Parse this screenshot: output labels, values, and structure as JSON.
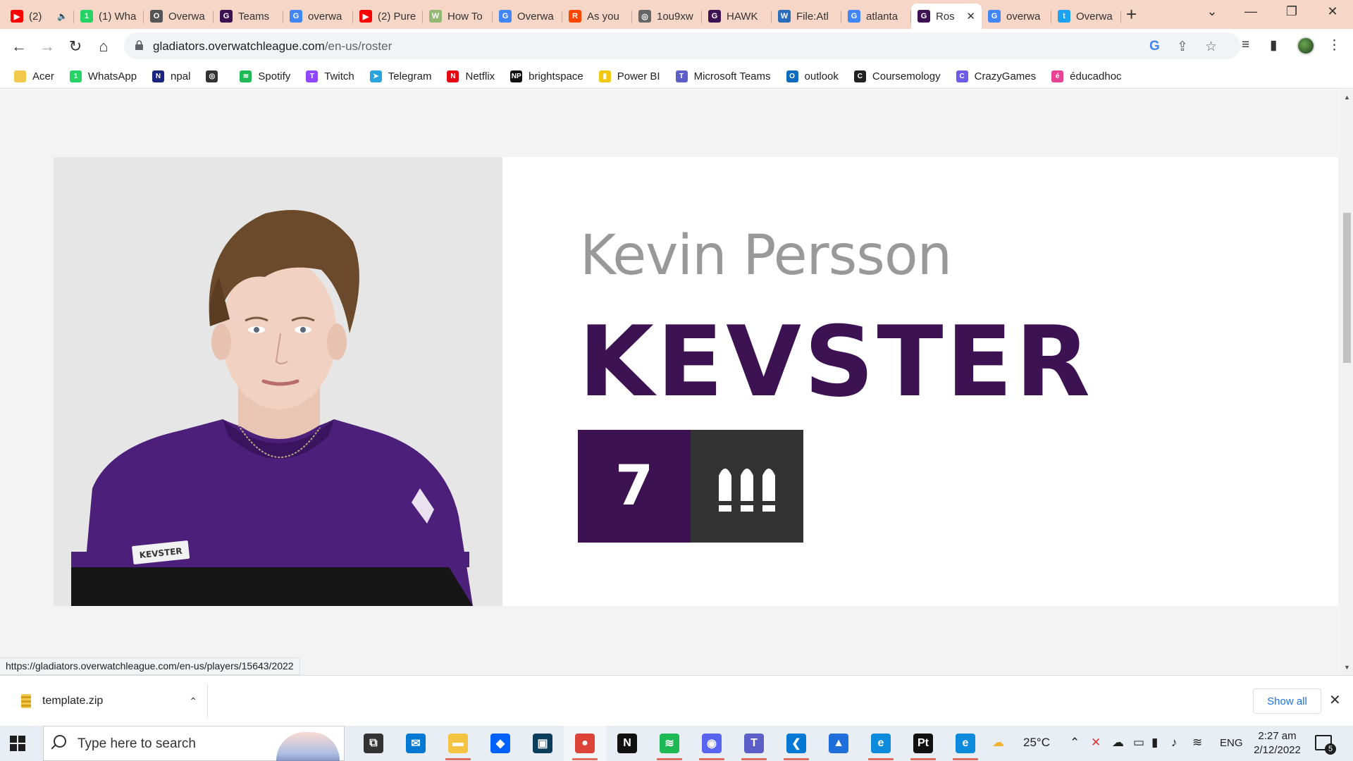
{
  "browser": {
    "tabs": [
      {
        "title": "(2)",
        "fav": "youtube-icon",
        "color": "#ff0000",
        "glyph": "▶",
        "muted": true
      },
      {
        "title": "(1) Wha",
        "fav": "whatsapp-icon",
        "color": "#25d366",
        "glyph": "1"
      },
      {
        "title": "Overwa",
        "fav": "overwatch-icon",
        "color": "#555555",
        "glyph": "O"
      },
      {
        "title": "Teams",
        "fav": "gladiators-icon",
        "color": "#3d1253",
        "glyph": "G"
      },
      {
        "title": "overwa",
        "fav": "google-icon",
        "color": "#4285f4",
        "glyph": "G"
      },
      {
        "title": "(2) Pure",
        "fav": "youtube-icon",
        "color": "#ff0000",
        "glyph": "▶"
      },
      {
        "title": "How To",
        "fav": "wikihow-icon",
        "color": "#93b874",
        "glyph": "W"
      },
      {
        "title": "Overwa",
        "fav": "google-icon",
        "color": "#4285f4",
        "glyph": "G"
      },
      {
        "title": "As you",
        "fav": "reddit-icon",
        "color": "#ff4500",
        "glyph": "R"
      },
      {
        "title": "1ou9xw",
        "fav": "globe-icon",
        "color": "#666666",
        "glyph": "◎"
      },
      {
        "title": "HAWK",
        "fav": "gladiators-icon",
        "color": "#3d1253",
        "glyph": "G"
      },
      {
        "title": "File:Atl",
        "fav": "wiki-icon",
        "color": "#2a6ebb",
        "glyph": "W"
      },
      {
        "title": "atlanta",
        "fav": "google-icon",
        "color": "#4285f4",
        "glyph": "G"
      },
      {
        "title": "Ros",
        "fav": "gladiators-icon",
        "color": "#3d1253",
        "glyph": "G",
        "active": true
      },
      {
        "title": "overwa",
        "fav": "google-icon",
        "color": "#4285f4",
        "glyph": "G"
      },
      {
        "title": "Overwa",
        "fav": "twitter-icon",
        "color": "#1da1f2",
        "glyph": "t"
      }
    ],
    "url": {
      "host": "gladiators.overwatchleague.com",
      "path": "/en-us/roster"
    },
    "bookmarks": [
      {
        "label": "Acer",
        "color": "#f2c94c",
        "glyph": ""
      },
      {
        "label": "WhatsApp",
        "color": "#25d366",
        "glyph": "1"
      },
      {
        "label": "npal",
        "color": "#1a237e",
        "glyph": "N"
      },
      {
        "label": "",
        "color": "#333333",
        "glyph": "◎"
      },
      {
        "label": "Spotify",
        "color": "#1db954",
        "glyph": "≋"
      },
      {
        "label": "Twitch",
        "color": "#9146ff",
        "glyph": "T"
      },
      {
        "label": "Telegram",
        "color": "#2aa3df",
        "glyph": "➤"
      },
      {
        "label": "Netflix",
        "color": "#e50914",
        "glyph": "N"
      },
      {
        "label": "brightspace",
        "color": "#111111",
        "glyph": "NP"
      },
      {
        "label": "Power BI",
        "color": "#f2c811",
        "glyph": "▮"
      },
      {
        "label": "Microsoft Teams",
        "color": "#5b5fc7",
        "glyph": "T"
      },
      {
        "label": "outlook",
        "color": "#0f6cbd",
        "glyph": "O"
      },
      {
        "label": "Coursemology",
        "color": "#222222",
        "glyph": "C"
      },
      {
        "label": "CrazyGames",
        "color": "#6c5ce7",
        "glyph": "C"
      },
      {
        "label": "éducadhoc",
        "color": "#e84393",
        "glyph": "é"
      }
    ]
  },
  "player": {
    "real_name": "Kevin Persson",
    "gamertag": "KEVSTER",
    "number": "7",
    "role_icon": "damage-role-icon",
    "jersey_label": "KEVSTER"
  },
  "status_url": "https://gladiators.overwatchleague.com/en-us/players/15643/2022",
  "download": {
    "filename": "template.zip",
    "show_all": "Show all"
  },
  "taskbar": {
    "search_placeholder": "Type here to search",
    "apps": [
      {
        "name": "task-view-icon",
        "color": "#333333",
        "glyph": "⧉"
      },
      {
        "name": "mail-icon",
        "color": "#0078d4",
        "glyph": "✉"
      },
      {
        "name": "file-explorer-icon",
        "color": "#f5c342",
        "glyph": "▬",
        "running": true
      },
      {
        "name": "dropbox-icon",
        "color": "#0061ff",
        "glyph": "◆"
      },
      {
        "name": "app-icon",
        "color": "#0b3d5c",
        "glyph": "▣"
      },
      {
        "name": "chrome-icon",
        "color": "#db4437",
        "glyph": "●",
        "running": true,
        "active": true
      },
      {
        "name": "netflix-icon",
        "color": "#111111",
        "glyph": "N"
      },
      {
        "name": "spotify-icon",
        "color": "#1db954",
        "glyph": "≋",
        "running": true
      },
      {
        "name": "discord-icon",
        "color": "#5865f2",
        "glyph": "◉",
        "running": true
      },
      {
        "name": "teams-icon",
        "color": "#5b5fc7",
        "glyph": "T",
        "running": true
      },
      {
        "name": "vscode-icon",
        "color": "#0078d4",
        "glyph": "❮",
        "running": true
      },
      {
        "name": "photos-icon",
        "color": "#1e6fd9",
        "glyph": "▲"
      },
      {
        "name": "edge-icon",
        "color": "#0c8adb",
        "glyph": "e",
        "running": true
      },
      {
        "name": "pycharm-icon",
        "color": "#111111",
        "glyph": "Pt",
        "running": true
      },
      {
        "name": "edge-dev-icon",
        "color": "#0c8adb",
        "glyph": "e",
        "running": true
      }
    ],
    "weather": "25°C",
    "language": "ENG",
    "time": "2:27 am",
    "date": "2/12/2022",
    "notifications": "5"
  }
}
